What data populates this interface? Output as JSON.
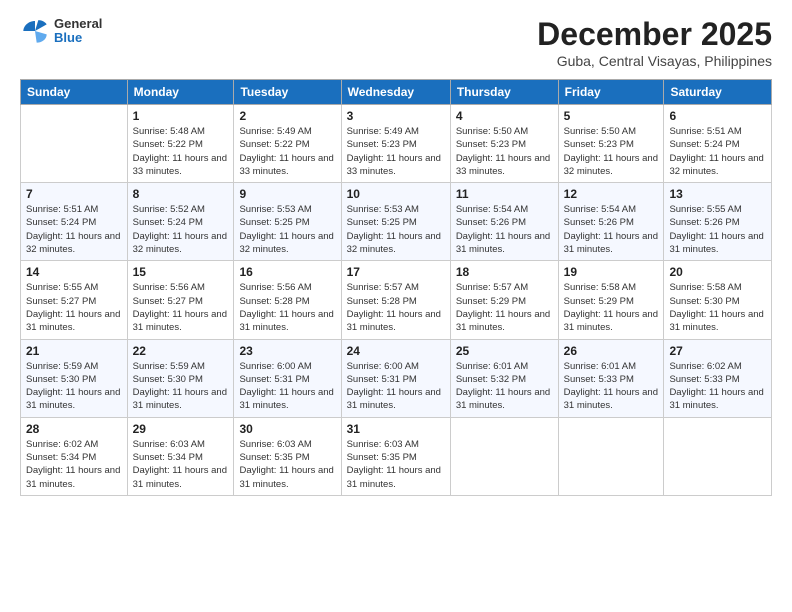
{
  "header": {
    "logo": {
      "general": "General",
      "blue": "Blue"
    },
    "title": "December 2025",
    "location": "Guba, Central Visayas, Philippines"
  },
  "weekdays": [
    "Sunday",
    "Monday",
    "Tuesday",
    "Wednesday",
    "Thursday",
    "Friday",
    "Saturday"
  ],
  "weeks": [
    [
      {
        "day": "",
        "sunrise": "",
        "sunset": "",
        "daylight": ""
      },
      {
        "day": "1",
        "sunrise": "Sunrise: 5:48 AM",
        "sunset": "Sunset: 5:22 PM",
        "daylight": "Daylight: 11 hours and 33 minutes."
      },
      {
        "day": "2",
        "sunrise": "Sunrise: 5:49 AM",
        "sunset": "Sunset: 5:22 PM",
        "daylight": "Daylight: 11 hours and 33 minutes."
      },
      {
        "day": "3",
        "sunrise": "Sunrise: 5:49 AM",
        "sunset": "Sunset: 5:23 PM",
        "daylight": "Daylight: 11 hours and 33 minutes."
      },
      {
        "day": "4",
        "sunrise": "Sunrise: 5:50 AM",
        "sunset": "Sunset: 5:23 PM",
        "daylight": "Daylight: 11 hours and 33 minutes."
      },
      {
        "day": "5",
        "sunrise": "Sunrise: 5:50 AM",
        "sunset": "Sunset: 5:23 PM",
        "daylight": "Daylight: 11 hours and 32 minutes."
      },
      {
        "day": "6",
        "sunrise": "Sunrise: 5:51 AM",
        "sunset": "Sunset: 5:24 PM",
        "daylight": "Daylight: 11 hours and 32 minutes."
      }
    ],
    [
      {
        "day": "7",
        "sunrise": "Sunrise: 5:51 AM",
        "sunset": "Sunset: 5:24 PM",
        "daylight": "Daylight: 11 hours and 32 minutes."
      },
      {
        "day": "8",
        "sunrise": "Sunrise: 5:52 AM",
        "sunset": "Sunset: 5:24 PM",
        "daylight": "Daylight: 11 hours and 32 minutes."
      },
      {
        "day": "9",
        "sunrise": "Sunrise: 5:53 AM",
        "sunset": "Sunset: 5:25 PM",
        "daylight": "Daylight: 11 hours and 32 minutes."
      },
      {
        "day": "10",
        "sunrise": "Sunrise: 5:53 AM",
        "sunset": "Sunset: 5:25 PM",
        "daylight": "Daylight: 11 hours and 32 minutes."
      },
      {
        "day": "11",
        "sunrise": "Sunrise: 5:54 AM",
        "sunset": "Sunset: 5:26 PM",
        "daylight": "Daylight: 11 hours and 31 minutes."
      },
      {
        "day": "12",
        "sunrise": "Sunrise: 5:54 AM",
        "sunset": "Sunset: 5:26 PM",
        "daylight": "Daylight: 11 hours and 31 minutes."
      },
      {
        "day": "13",
        "sunrise": "Sunrise: 5:55 AM",
        "sunset": "Sunset: 5:26 PM",
        "daylight": "Daylight: 11 hours and 31 minutes."
      }
    ],
    [
      {
        "day": "14",
        "sunrise": "Sunrise: 5:55 AM",
        "sunset": "Sunset: 5:27 PM",
        "daylight": "Daylight: 11 hours and 31 minutes."
      },
      {
        "day": "15",
        "sunrise": "Sunrise: 5:56 AM",
        "sunset": "Sunset: 5:27 PM",
        "daylight": "Daylight: 11 hours and 31 minutes."
      },
      {
        "day": "16",
        "sunrise": "Sunrise: 5:56 AM",
        "sunset": "Sunset: 5:28 PM",
        "daylight": "Daylight: 11 hours and 31 minutes."
      },
      {
        "day": "17",
        "sunrise": "Sunrise: 5:57 AM",
        "sunset": "Sunset: 5:28 PM",
        "daylight": "Daylight: 11 hours and 31 minutes."
      },
      {
        "day": "18",
        "sunrise": "Sunrise: 5:57 AM",
        "sunset": "Sunset: 5:29 PM",
        "daylight": "Daylight: 11 hours and 31 minutes."
      },
      {
        "day": "19",
        "sunrise": "Sunrise: 5:58 AM",
        "sunset": "Sunset: 5:29 PM",
        "daylight": "Daylight: 11 hours and 31 minutes."
      },
      {
        "day": "20",
        "sunrise": "Sunrise: 5:58 AM",
        "sunset": "Sunset: 5:30 PM",
        "daylight": "Daylight: 11 hours and 31 minutes."
      }
    ],
    [
      {
        "day": "21",
        "sunrise": "Sunrise: 5:59 AM",
        "sunset": "Sunset: 5:30 PM",
        "daylight": "Daylight: 11 hours and 31 minutes."
      },
      {
        "day": "22",
        "sunrise": "Sunrise: 5:59 AM",
        "sunset": "Sunset: 5:30 PM",
        "daylight": "Daylight: 11 hours and 31 minutes."
      },
      {
        "day": "23",
        "sunrise": "Sunrise: 6:00 AM",
        "sunset": "Sunset: 5:31 PM",
        "daylight": "Daylight: 11 hours and 31 minutes."
      },
      {
        "day": "24",
        "sunrise": "Sunrise: 6:00 AM",
        "sunset": "Sunset: 5:31 PM",
        "daylight": "Daylight: 11 hours and 31 minutes."
      },
      {
        "day": "25",
        "sunrise": "Sunrise: 6:01 AM",
        "sunset": "Sunset: 5:32 PM",
        "daylight": "Daylight: 11 hours and 31 minutes."
      },
      {
        "day": "26",
        "sunrise": "Sunrise: 6:01 AM",
        "sunset": "Sunset: 5:33 PM",
        "daylight": "Daylight: 11 hours and 31 minutes."
      },
      {
        "day": "27",
        "sunrise": "Sunrise: 6:02 AM",
        "sunset": "Sunset: 5:33 PM",
        "daylight": "Daylight: 11 hours and 31 minutes."
      }
    ],
    [
      {
        "day": "28",
        "sunrise": "Sunrise: 6:02 AM",
        "sunset": "Sunset: 5:34 PM",
        "daylight": "Daylight: 11 hours and 31 minutes."
      },
      {
        "day": "29",
        "sunrise": "Sunrise: 6:03 AM",
        "sunset": "Sunset: 5:34 PM",
        "daylight": "Daylight: 11 hours and 31 minutes."
      },
      {
        "day": "30",
        "sunrise": "Sunrise: 6:03 AM",
        "sunset": "Sunset: 5:35 PM",
        "daylight": "Daylight: 11 hours and 31 minutes."
      },
      {
        "day": "31",
        "sunrise": "Sunrise: 6:03 AM",
        "sunset": "Sunset: 5:35 PM",
        "daylight": "Daylight: 11 hours and 31 minutes."
      },
      {
        "day": "",
        "sunrise": "",
        "sunset": "",
        "daylight": ""
      },
      {
        "day": "",
        "sunrise": "",
        "sunset": "",
        "daylight": ""
      },
      {
        "day": "",
        "sunrise": "",
        "sunset": "",
        "daylight": ""
      }
    ]
  ]
}
